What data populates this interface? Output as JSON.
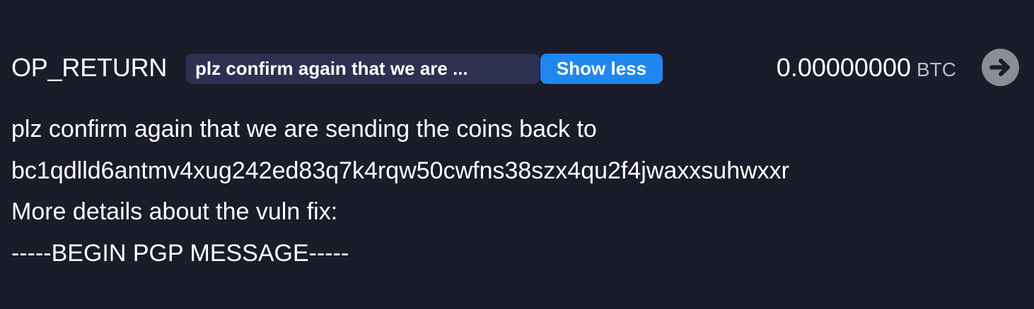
{
  "output": {
    "type_label": "OP_RETURN",
    "data_preview": "plz confirm again that we are ...",
    "toggle_label": "Show less",
    "amount": "0.00000000",
    "unit": "BTC",
    "arrow_icon": "arrow-right-circle-icon"
  },
  "message": {
    "lines": [
      "plz confirm again that we are sending the coins back to",
      "bc1qdlld6antmv4xug242ed83q7k4rqw50cwfns38szx4qu2f4jwaxxsuhwxxr",
      "More details about the vuln fix:",
      "-----BEGIN PGP MESSAGE-----"
    ]
  },
  "colors": {
    "background": "#1a1c29",
    "pill_background": "#2d3050",
    "accent": "#1f86f0",
    "arrow_button": "#8b8d96"
  }
}
